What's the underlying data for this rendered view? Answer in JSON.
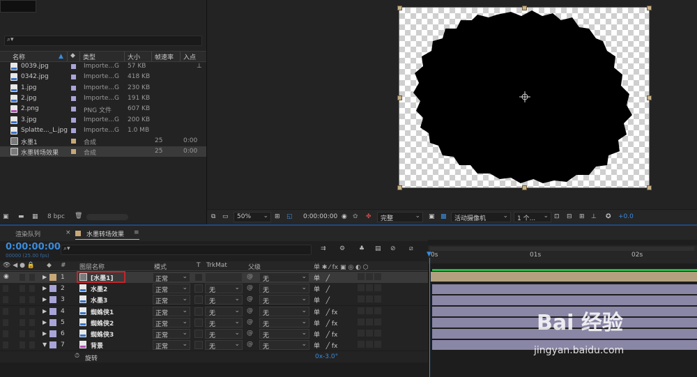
{
  "project": {
    "search_placeholder": "⌕▾",
    "columns": {
      "name": "名称",
      "type": "类型",
      "size": "大小",
      "framerate": "帧速率",
      "inpoint": "入点"
    },
    "items": [
      {
        "name": "0039.jpg",
        "icon": "jpg",
        "type": "Importe...G",
        "size": "57 KB",
        "fps": "",
        "in": "",
        "label_color": "#a8a4d8"
      },
      {
        "name": "0342.jpg",
        "icon": "jpg",
        "type": "Importe...G",
        "size": "418 KB",
        "fps": "",
        "in": "",
        "label_color": "#a8a4d8"
      },
      {
        "name": "1.jpg",
        "icon": "jpg",
        "type": "Importe...G",
        "size": "230 KB",
        "fps": "",
        "in": "",
        "label_color": "#a8a4d8"
      },
      {
        "name": "2.jpg",
        "icon": "jpg",
        "type": "Importe...G",
        "size": "191 KB",
        "fps": "",
        "in": "",
        "label_color": "#a8a4d8"
      },
      {
        "name": "2.png",
        "icon": "png",
        "type": "PNG 文件",
        "size": "607 KB",
        "fps": "",
        "in": "",
        "label_color": "#a8a4d8"
      },
      {
        "name": "3.jpg",
        "icon": "jpg",
        "type": "Importe...G",
        "size": "200 KB",
        "fps": "",
        "in": "",
        "label_color": "#a8a4d8"
      },
      {
        "name": "Splatte..._L.jpg",
        "icon": "jpg",
        "type": "Importe...G",
        "size": "1.0 MB",
        "fps": "",
        "in": "",
        "label_color": "#a8a4d8"
      },
      {
        "name": "水墨1",
        "icon": "comp",
        "type": "合成",
        "size": "",
        "fps": "25",
        "in": "0:00",
        "label_color": "#c8a878"
      },
      {
        "name": "水墨转场效果",
        "icon": "comp",
        "type": "合成",
        "size": "",
        "fps": "25",
        "in": "0:00",
        "label_color": "#c8a878"
      }
    ],
    "bpc": "8 bpc"
  },
  "viewer": {
    "zoom": "50%",
    "timecode": "0:00:00:00",
    "resolution": "完整",
    "camera": "活动摄像机",
    "views": "1 个...",
    "exposure": "+0.0"
  },
  "timeline": {
    "tabs": {
      "render_queue": "渲染队列",
      "comp": "水墨转场效果"
    },
    "current_time": "0:00:00:00",
    "frame_info": "00000 (25.00 fps)",
    "search_icon": "⌕▾",
    "columns": {
      "num": "#",
      "layer_name": "图层名称",
      "mode": "模式",
      "t": "T",
      "trkmat": "TrkMat",
      "parent": "父级",
      "switches": "单 ✱ ⁄ fx ▣ ◎ ◐ ⬡"
    },
    "ruler": [
      "0s",
      "01s",
      "02s"
    ],
    "layers": [
      {
        "num": "1",
        "name": "[水墨1]",
        "icon": "comp",
        "label_color": "#c8a878",
        "mode": "正常",
        "trkmat": "",
        "parent": "无",
        "fx": "",
        "expanded": false,
        "selected": true
      },
      {
        "num": "2",
        "name": "水墨2",
        "icon": "jpg",
        "label_color": "#a8a4d8",
        "mode": "正常",
        "trkmat": "无",
        "parent": "无",
        "fx": "",
        "expanded": false,
        "selected": false
      },
      {
        "num": "3",
        "name": "水墨3",
        "icon": "jpg",
        "label_color": "#a8a4d8",
        "mode": "正常",
        "trkmat": "无",
        "parent": "无",
        "fx": "",
        "expanded": false,
        "selected": false
      },
      {
        "num": "4",
        "name": "蜘蛛侠1",
        "icon": "jpg",
        "label_color": "#a8a4d8",
        "mode": "正常",
        "trkmat": "无",
        "parent": "无",
        "fx": "fx",
        "expanded": false,
        "selected": false
      },
      {
        "num": "5",
        "name": "蜘蛛侠2",
        "icon": "jpg",
        "label_color": "#a8a4d8",
        "mode": "正常",
        "trkmat": "无",
        "parent": "无",
        "fx": "fx",
        "expanded": false,
        "selected": false
      },
      {
        "num": "6",
        "name": "蜘蛛侠3",
        "icon": "jpg",
        "label_color": "#a8a4d8",
        "mode": "正常",
        "trkmat": "无",
        "parent": "无",
        "fx": "fx",
        "expanded": false,
        "selected": false
      },
      {
        "num": "7",
        "name": "背景",
        "icon": "png",
        "label_color": "#a8a4d8",
        "mode": "正常",
        "trkmat": "无",
        "parent": "无",
        "fx": "fx",
        "expanded": true,
        "selected": false
      }
    ],
    "property": {
      "name": "旋转",
      "value": "0x-3.0°"
    }
  },
  "watermark": {
    "brand": "Bai 经验",
    "url": "jingyan.baidu.com"
  }
}
